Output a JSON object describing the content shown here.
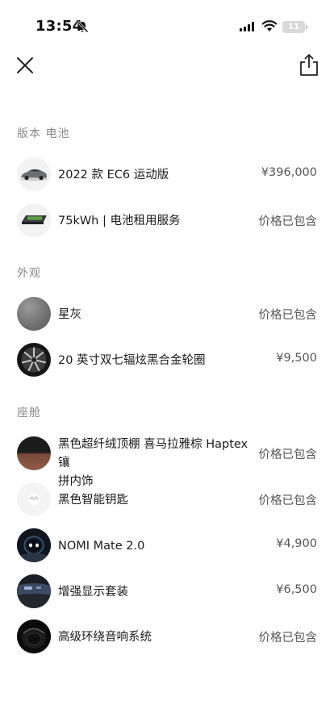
{
  "status_bar": {
    "time": "13:54",
    "battery_level": "11"
  },
  "nav": {
    "close_icon": "close-icon",
    "share_icon": "share-icon"
  },
  "sections": [
    {
      "title": "版本 电池",
      "items": [
        {
          "name": "2022 款 EC6 运动版",
          "price": "¥396,000",
          "thumb": "car-thumbnail"
        },
        {
          "name": "75kWh | 电池租用服务",
          "price": "价格已包含",
          "thumb": "battery-thumbnail"
        }
      ]
    },
    {
      "title": "外观",
      "items": [
        {
          "name": "星灰",
          "price": "价格已包含",
          "thumb": "paint-swatch"
        },
        {
          "name": "20 英寸双七辐炫黑合金轮圈",
          "price": "¥9,500",
          "thumb": "wheel-thumbnail"
        }
      ]
    },
    {
      "title": "座舱",
      "items": [
        {
          "name_line1": "黑色超纤绒顶棚 喜马拉雅棕 Haptex 镶",
          "name_line2": "拼内饰",
          "price": "价格已包含",
          "thumb": "interior-swatch"
        },
        {
          "name": "黑色智能钥匙",
          "price": "价格已包含",
          "thumb": "key-thumbnail"
        },
        {
          "name": "NOMI Mate 2.0",
          "price": "¥4,900",
          "thumb": "nomi-thumbnail"
        },
        {
          "name": "增强显示套装",
          "price": "¥6,500",
          "thumb": "display-thumbnail"
        },
        {
          "name": "高级环绕音响系统",
          "price": "价格已包含",
          "thumb": "speaker-thumbnail"
        }
      ]
    }
  ]
}
